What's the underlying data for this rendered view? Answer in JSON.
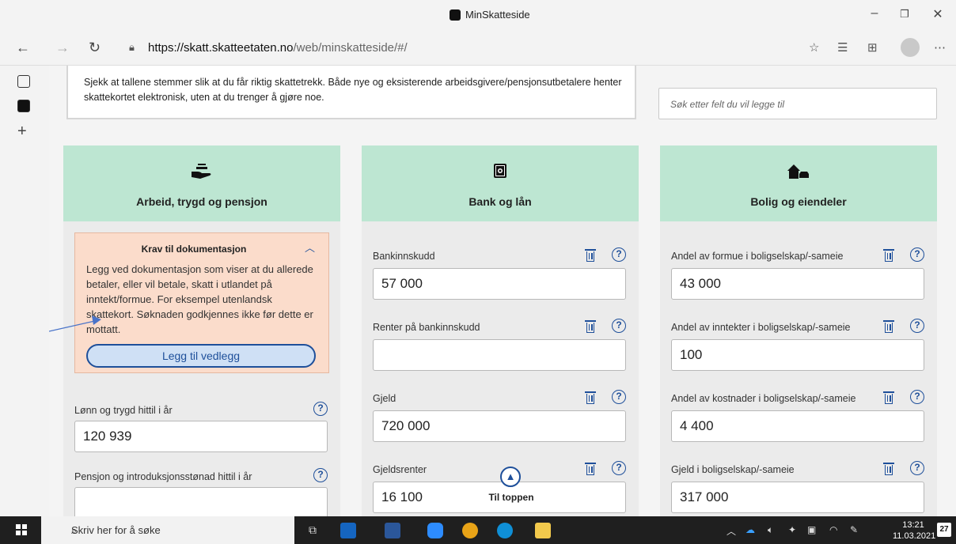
{
  "browser": {
    "window_title": "MinSkatteside",
    "url_host": "https://skatt.skatteetaten.no",
    "url_path": "/web/minskatteside/#/"
  },
  "notice": {
    "text": "Sjekk at tallene stemmer slik at du får riktig skattetrekk. Både nye og eksisterende arbeidsgivere/pensjonsutbetalere henter skattekortet elektronisk, uten at du trenger å gjøre noe."
  },
  "search": {
    "placeholder": "Søk etter felt du vil legge til"
  },
  "columns": [
    {
      "title": "Arbeid, trygd og pensjon",
      "icon": "hand-money-icon",
      "doc_box": {
        "title": "Krav til dokumentasjon",
        "text": "Legg ved dokumentasjon som viser at du allerede betaler, eller vil betale, skatt i utlandet på inntekt/formue. For eksempel utenlandsk skattekort. Søknaden godkjennes ikke før dette er mottatt.",
        "button": "Legg til vedlegg"
      },
      "fields": [
        {
          "label": "Lønn og trygd hittil i år",
          "value": "120 939"
        },
        {
          "label": "Pensjon og introduksjonsstønad hittil i år",
          "value": ""
        }
      ]
    },
    {
      "title": "Bank og lån",
      "icon": "safe-icon",
      "fields": [
        {
          "label": "Bankinnskudd",
          "value": "57 000"
        },
        {
          "label": "Renter på bankinnskudd",
          "value": ""
        },
        {
          "label": "Gjeld",
          "value": "720 000"
        },
        {
          "label": "Gjeldsrenter",
          "value": "16 100"
        }
      ]
    },
    {
      "title": "Bolig og eiendeler",
      "icon": "house-car-icon",
      "fields": [
        {
          "label": "Andel av formue i boligselskap/-sameie",
          "value": "43 000"
        },
        {
          "label": "Andel av inntekter i boligselskap/-sameie",
          "value": "100"
        },
        {
          "label": "Andel av kostnader i boligselskap/-sameie",
          "value": "4 400"
        },
        {
          "label": "Gjeld i boligselskap/-sameie",
          "value": "317 000"
        }
      ]
    }
  ],
  "scroll_top": {
    "label": "Til toppen"
  },
  "taskbar": {
    "search_placeholder": "Skriv her for å søke",
    "time": "13:21",
    "date": "11.03.2021",
    "notifications": "27"
  }
}
